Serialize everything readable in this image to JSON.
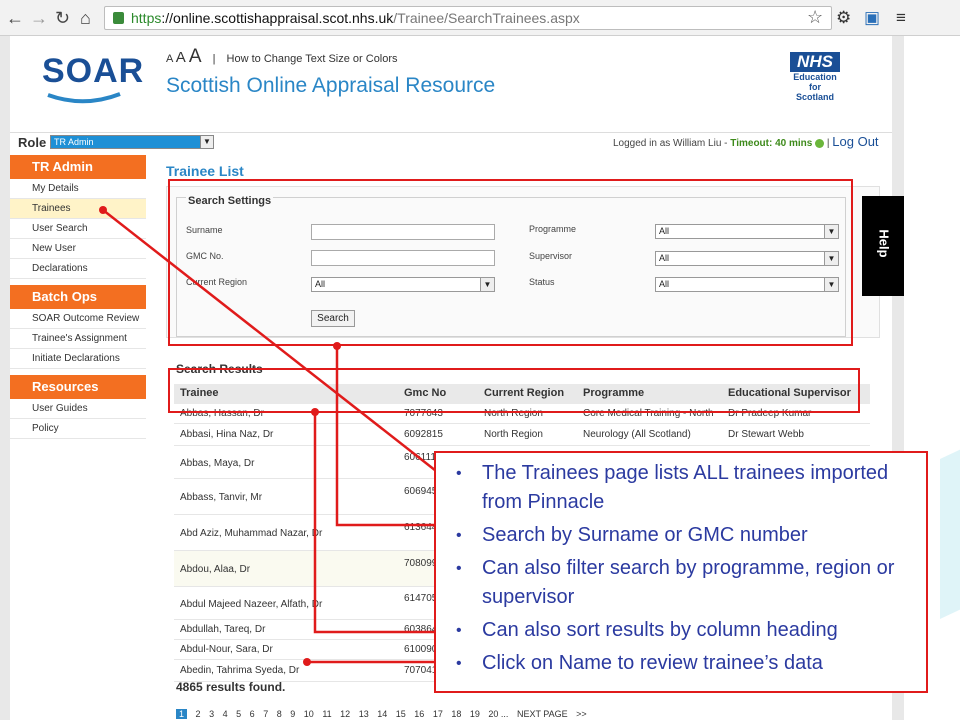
{
  "browser": {
    "url_secure": "https",
    "url_host": "://online.scottishappraisal.scot.nhs.uk",
    "url_path": "/Trainee/SearchTrainees.aspx"
  },
  "header": {
    "logo": "SOAR",
    "text_size_a": "A",
    "text_size_link": "How to Change Text Size or Colors",
    "site_title": "Scottish Online Appraisal Resource",
    "nhs_logo": "NHS",
    "nhs_lines": [
      "Education",
      "for",
      "Scotland"
    ]
  },
  "rolebar": {
    "role_label": "Role",
    "role_value": "TR Admin",
    "logged_in": "Logged in as William Liu - ",
    "timeout": "Timeout: 40 mins",
    "logout": "Log Out"
  },
  "sidebar": {
    "groups": [
      {
        "title": "TR Admin",
        "items": [
          "My Details",
          "Trainees",
          "User Search",
          "New User",
          "Declarations"
        ]
      },
      {
        "title": "Batch Ops",
        "items": [
          "SOAR Outcome Review",
          "Trainee's Assignment",
          "Initiate Declarations"
        ]
      },
      {
        "title": "Resources",
        "items": [
          "User Guides",
          "Policy"
        ]
      }
    ]
  },
  "main": {
    "title": "Trainee List",
    "search_settings": {
      "legend": "Search Settings",
      "surname_label": "Surname",
      "gmc_label": "GMC No.",
      "region_label": "Current Region",
      "region_value": "All",
      "programme_label": "Programme",
      "programme_value": "All",
      "supervisor_label": "Supervisor",
      "supervisor_value": "All",
      "status_label": "Status",
      "status_value": "All",
      "search_button": "Search"
    },
    "results_title": "Search Results",
    "columns": [
      "Trainee",
      "Gmc No",
      "Current Region",
      "Programme",
      "Educational Supervisor"
    ],
    "rows": [
      {
        "trainee": "Abbas, Hassan, Dr",
        "gmc": "7077643",
        "region": "North Region",
        "programme": "Core Medical Training - North",
        "supervisor": "Dr Pradeep Kumar"
      },
      {
        "trainee": "Abbasi, Hina Naz, Dr",
        "gmc": "6092815",
        "region": "North Region",
        "programme": "Neurology (All Scotland)",
        "supervisor": "Dr Stewart Webb"
      },
      {
        "trainee": "Abbas, Maya, Dr",
        "gmc": "6061117",
        "region": "",
        "programme": "",
        "supervisor": ""
      },
      {
        "trainee": "Abbass, Tanvir, Mr",
        "gmc": "6069459",
        "region": "",
        "programme": "",
        "supervisor": ""
      },
      {
        "trainee": "Abd Aziz, Muhammad Nazar, Dr",
        "gmc": "6136441",
        "region": "",
        "programme": "",
        "supervisor": ""
      },
      {
        "trainee": "Abdou, Alaa, Dr",
        "gmc": "7080999",
        "region": "",
        "programme": "",
        "supervisor": ""
      },
      {
        "trainee": "Abdul Majeed Nazeer, Alfath, Dr",
        "gmc": "6147059",
        "region": "",
        "programme": "",
        "supervisor": ""
      },
      {
        "trainee": "Abdullah, Tareq, Dr",
        "gmc": "6038648",
        "region": "",
        "programme": "",
        "supervisor": ""
      },
      {
        "trainee": "Abdul-Nour, Sara, Dr",
        "gmc": "6100903",
        "region": "",
        "programme": "",
        "supervisor": ""
      },
      {
        "trainee": "Abedin, Tahrima Syeda, Dr",
        "gmc": "7070417",
        "region": "",
        "programme": "",
        "supervisor": ""
      }
    ],
    "results_found": "4865 results found.",
    "pages": [
      "1",
      "2",
      "3",
      "4",
      "5",
      "6",
      "7",
      "8",
      "9",
      "10",
      "11",
      "12",
      "13",
      "14",
      "15",
      "16",
      "17",
      "18",
      "19",
      "20 ...",
      "NEXT PAGE",
      ">>"
    ],
    "help": "Help"
  },
  "callout": {
    "bullets": [
      "The Trainees page lists ALL trainees imported from Pinnacle",
      "Search by Surname or GMC number",
      "Can also filter search by programme, region or supervisor",
      "Can also sort results by column heading",
      "Click on Name to review trainee’s data"
    ]
  },
  "colors": {
    "accent_orange": "#f36f21",
    "title_blue": "#2a86c6",
    "annotation_red": "#e01b1b",
    "callout_text": "#2b3aa0"
  }
}
